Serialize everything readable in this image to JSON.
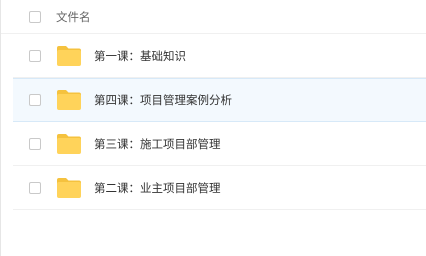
{
  "header": {
    "column_label": "文件名"
  },
  "files": [
    {
      "name": "第一课：基础知识"
    },
    {
      "name": "第四课：项目管理案例分析"
    },
    {
      "name": "第三课：施工项目部管理"
    },
    {
      "name": "第二课：业主项目部管理"
    }
  ],
  "colors": {
    "folder": "#ffd35a",
    "folder_tab": "#f5c23e",
    "highlight_bg": "#f3f9fe"
  }
}
